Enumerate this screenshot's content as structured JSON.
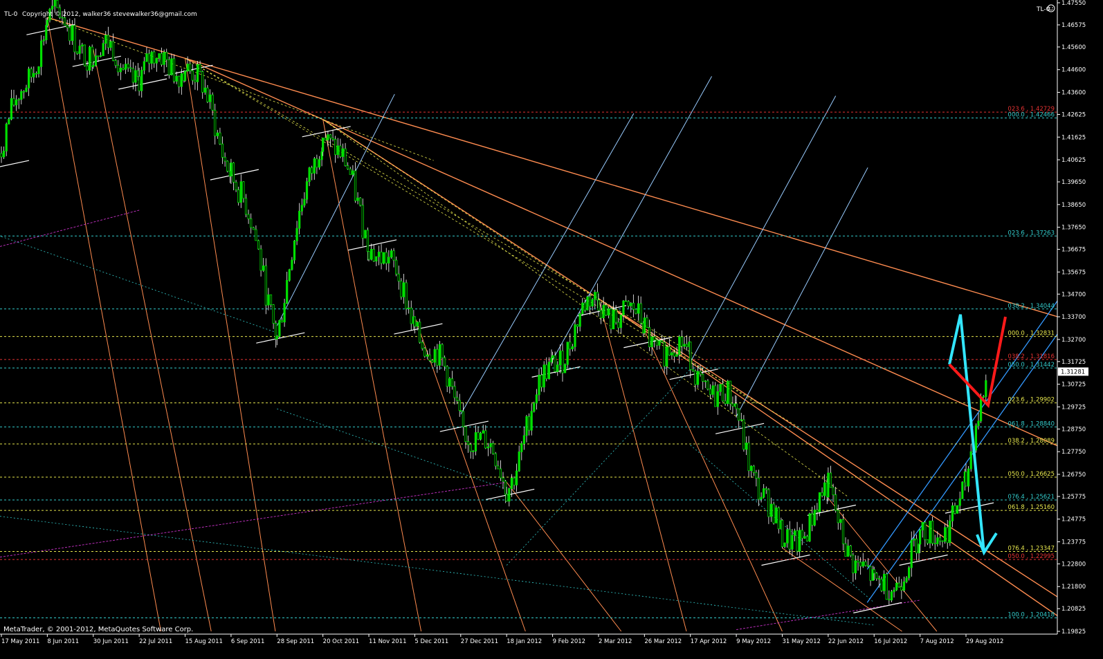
{
  "header": {
    "symbol_label": "TL-0",
    "copyright": "Copyright © 2012, walker36  stevewalker36@gmail.com",
    "tl_marker": "TL-0"
  },
  "footer": {
    "watermark": "MetaTrader, © 2001-2012, MetaQuotes Software Corp."
  },
  "colors": {
    "background": "#000000",
    "candle": "#00e000",
    "candle_wick": "#ffffff",
    "axis_text": "#ffffff",
    "orange_line": "#ff8c50",
    "cyan_level": "#33cccc",
    "yellow_level": "#e6e64d",
    "red_level": "#e63333",
    "white_line": "#ffffff",
    "light_blue": "#99ccff",
    "blue_channel": "#3399ff",
    "magenta": "#cc33cc",
    "cyan_arrow": "#33e6ff",
    "red_arrow": "#ff1a1a"
  },
  "chart_data": {
    "type": "line",
    "x_axis_labels": [
      "17 May 2011",
      "8 Jun 2011",
      "30 Jun 2011",
      "22 Jul 2011",
      "15 Aug 2011",
      "6 Sep 2011",
      "28 Sep 2011",
      "20 Oct 2011",
      "11 Nov 2011",
      "5 Dec 2011",
      "27 Dec 2011",
      "18 Jan 2012",
      "9 Feb 2012",
      "2 Mar 2012",
      "26 Mar 2012",
      "17 Apr 2012",
      "9 May 2012",
      "31 May 2012",
      "22 Jun 2012",
      "16 Jul 2012",
      "7 Aug 2012",
      "29 Aug 2012"
    ],
    "y_axis_labels": [
      "1.47550",
      "1.46575",
      "1.45600",
      "1.44600",
      "1.43600",
      "1.42625",
      "1.41625",
      "1.40625",
      "1.39650",
      "1.38650",
      "1.37650",
      "1.36675",
      "1.35675",
      "1.34700",
      "1.33700",
      "1.32700",
      "1.31725",
      "1.30725",
      "1.29725",
      "1.28750",
      "1.27750",
      "1.26750",
      "1.25775",
      "1.24775",
      "1.23775",
      "1.22800",
      "1.21800",
      "1.20825",
      "1.19825"
    ],
    "ylim": [
      1.19825,
      1.4755
    ],
    "current_price": "1.31281",
    "price_path": [
      {
        "date": "17 May 2011",
        "price": 1.409
      },
      {
        "date": "8 Jun 2011",
        "price": 1.469
      },
      {
        "date": "30 Jun 2011",
        "price": 1.455
      },
      {
        "date": "22 Jul 2011",
        "price": 1.445
      },
      {
        "date": "15 Aug 2011",
        "price": 1.451
      },
      {
        "date": "6 Sep 2011",
        "price": 1.405
      },
      {
        "date": "28 Sep 2011",
        "price": 1.333
      },
      {
        "date": "20 Oct 2011",
        "price": 1.424
      },
      {
        "date": "11 Nov 2011",
        "price": 1.374
      },
      {
        "date": "5 Dec 2011",
        "price": 1.337
      },
      {
        "date": "27 Dec 2011",
        "price": 1.294
      },
      {
        "date": "18 Jan 2012",
        "price": 1.264
      },
      {
        "date": "9 Feb 2012",
        "price": 1.318
      },
      {
        "date": "2 Mar 2012",
        "price": 1.345
      },
      {
        "date": "26 Mar 2012",
        "price": 1.331
      },
      {
        "date": "17 Apr 2012",
        "price": 1.317
      },
      {
        "date": "9 May 2012",
        "price": 1.293
      },
      {
        "date": "31 May 2012",
        "price": 1.235
      },
      {
        "date": "22 Jun 2012",
        "price": 1.257
      },
      {
        "date": "16 Jul 2012",
        "price": 1.214
      },
      {
        "date": "7 Aug 2012",
        "price": 1.235
      },
      {
        "date": "29 Aug 2012",
        "price": 1.258
      },
      {
        "date": "after 29 Aug 2012",
        "price": 1.315
      }
    ],
    "fib_levels": [
      {
        "label": "023.6 , 1.42729",
        "value": 1.42729,
        "color": "#e63333"
      },
      {
        "label": "000.0 , 1.42466",
        "value": 1.42466,
        "color": "#33cccc"
      },
      {
        "label": "023.6 , 1.37263",
        "value": 1.37263,
        "color": "#33cccc"
      },
      {
        "label": "038.2 , 1.34044",
        "value": 1.34044,
        "color": "#33cccc"
      },
      {
        "label": "000.0 , 1.32831",
        "value": 1.32831,
        "color": "#e6e64d"
      },
      {
        "label": "038.2 , 1.31816",
        "value": 1.31816,
        "color": "#e63333"
      },
      {
        "label": "050.0 , 1.31442",
        "value": 1.31442,
        "color": "#33cccc"
      },
      {
        "label": "023.6 , 1.29902",
        "value": 1.29902,
        "color": "#e6e64d"
      },
      {
        "label": "061.8 , 1.28840",
        "value": 1.2884,
        "color": "#33cccc"
      },
      {
        "label": "038.2 , 1.28089",
        "value": 1.28089,
        "color": "#e6e64d"
      },
      {
        "label": "050.0 , 1.26625",
        "value": 1.26625,
        "color": "#e6e64d"
      },
      {
        "label": "076.4 , 1.25621",
        "value": 1.25621,
        "color": "#33cccc"
      },
      {
        "label": "061.8 , 1.25160",
        "value": 1.2516,
        "color": "#e6e64d"
      },
      {
        "label": "076.4 , 1.23347",
        "value": 1.23347,
        "color": "#e6e64d"
      },
      {
        "label": "050.0 , 1.22995",
        "value": 1.22995,
        "color": "#e63333"
      },
      {
        "label": "100.0 , 1.20418",
        "value": 1.20418,
        "color": "#33cccc"
      }
    ],
    "projection": [
      {
        "name": "cyan",
        "points": [
          {
            "date": "29 Aug 2012",
            "price": 1.316
          },
          {
            "date": "after 29 Aug 2012",
            "price": 1.338
          },
          {
            "date": "after 29 Aug 2012",
            "price": 1.233
          }
        ]
      },
      {
        "name": "red",
        "points": [
          {
            "date": "29 Aug 2012",
            "price": 1.316
          },
          {
            "date": "after 29 Aug 2012",
            "price": 1.298
          },
          {
            "date": "after 29 Aug 2012",
            "price": 1.337
          }
        ]
      }
    ]
  }
}
